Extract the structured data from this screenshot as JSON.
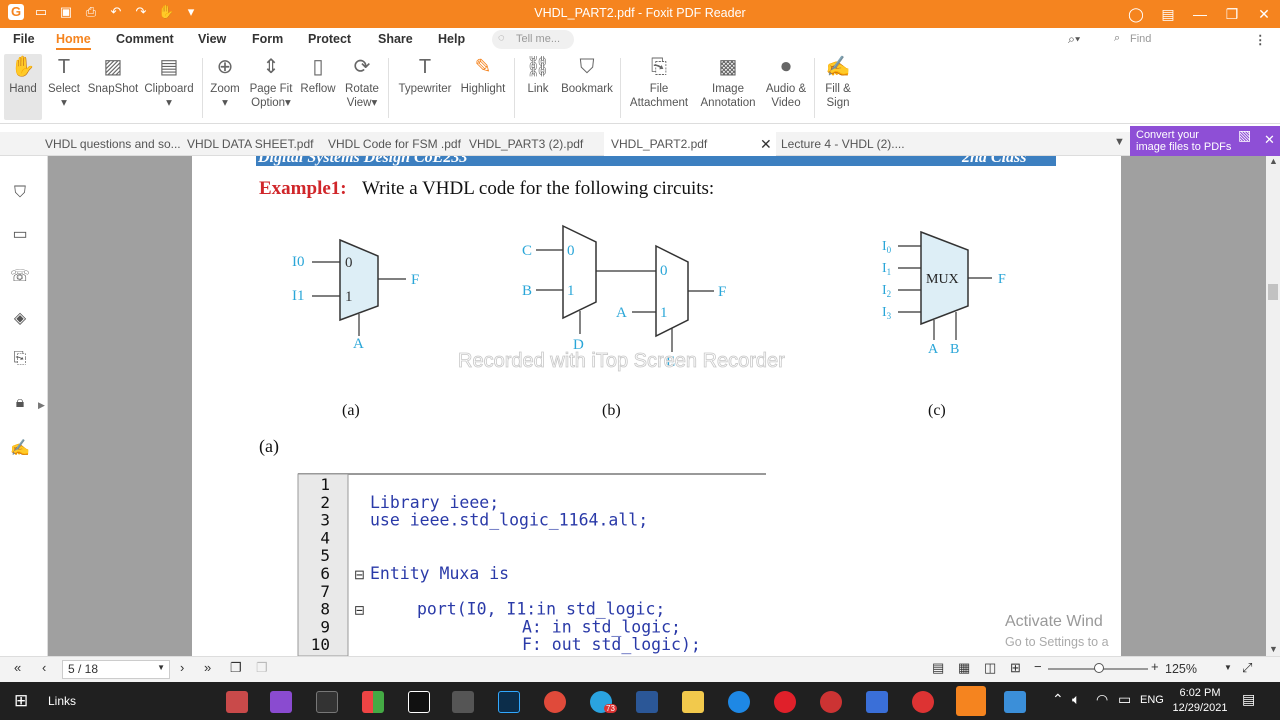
{
  "window": {
    "title": "VHDL_PART2.pdf - Foxit PDF Reader"
  },
  "menu": [
    "File",
    "Home",
    "Comment",
    "View",
    "Form",
    "Protect",
    "Share",
    "Help"
  ],
  "active_menu": "Home",
  "tellme_placeholder": "Tell me...",
  "find_placeholder": "Find",
  "ribbon": [
    {
      "label": "Hand",
      "icon": "hand-icon"
    },
    {
      "label": "Select",
      "icon": "select-icon"
    },
    {
      "label": "SnapShot",
      "icon": "snapshot-icon"
    },
    {
      "label": "Clipboard",
      "icon": "clipboard-icon"
    },
    {
      "label": "Zoom",
      "icon": "zoom-icon"
    },
    {
      "label": "Page Fit Option",
      "icon": "page-fit-icon"
    },
    {
      "label": "Reflow",
      "icon": "reflow-icon"
    },
    {
      "label": "Rotate View",
      "icon": "rotate-icon"
    },
    {
      "label": "Typewriter",
      "icon": "typewriter-icon"
    },
    {
      "label": "Highlight",
      "icon": "highlight-icon"
    },
    {
      "label": "Link",
      "icon": "link-icon"
    },
    {
      "label": "Bookmark",
      "icon": "bookmark-icon"
    },
    {
      "label": "File Attachment",
      "icon": "attachment-icon"
    },
    {
      "label": "Image Annotation",
      "icon": "image-annotation-icon"
    },
    {
      "label": "Audio & Video",
      "icon": "audio-video-icon"
    },
    {
      "label": "Fill & Sign",
      "icon": "fill-sign-icon"
    }
  ],
  "tabs": [
    "VHDL questions and so...",
    "VHDL DATA SHEET.pdf",
    "VHDL Code for FSM .pdf",
    "VHDL_PART3 (2).pdf",
    "VHDL_PART2.pdf",
    "Lecture 4 - VHDL  (2)...."
  ],
  "active_tab": "VHDL_PART2.pdf",
  "promo": {
    "line1": "Convert your",
    "line2": "image files to PDFs"
  },
  "document": {
    "header_text": "Digital Systems Design CoE233",
    "header_right": "2nd Class",
    "example_label": "Example1:",
    "example_text": "Write a VHDL code for the following circuits:",
    "fig_a": {
      "in0": "I0",
      "in1": "I1",
      "sel": "A",
      "out": "F",
      "p0": "0",
      "p1": "1",
      "caption": "(a)"
    },
    "fig_b": {
      "c": "C",
      "b": "B",
      "d": "D",
      "a": "A",
      "e": "E",
      "f": "F",
      "p0": "0",
      "p1": "1",
      "q0": "0",
      "q1": "1",
      "caption": "(b)"
    },
    "fig_c": {
      "i0": "I",
      "i1": "I",
      "i2": "I",
      "i3": "I",
      "s0": "0",
      "s1": "1",
      "s2": "2",
      "s3": "3",
      "mux": "MUX",
      "f": "F",
      "a": "A",
      "b": "B",
      "caption": "(c)"
    },
    "watermark": "Recorded with iTop Screen Recorder",
    "section": "(a)",
    "code_lines": [
      {
        "n": "1",
        "text": ""
      },
      {
        "n": "2",
        "text": "Library ieee;"
      },
      {
        "n": "3",
        "text": "use  ieee.std_logic_1164.all;"
      },
      {
        "n": "4",
        "text": ""
      },
      {
        "n": "5",
        "text": ""
      },
      {
        "n": "6",
        "text": "Entity Muxa is"
      },
      {
        "n": "7",
        "text": ""
      },
      {
        "n": "8",
        "text": "port(I0, I1:in std_logic;"
      },
      {
        "n": "9",
        "text": "A: in std_logic;"
      },
      {
        "n": "10",
        "text": "F: out std_logic);"
      }
    ],
    "activate_line1": "Activate Wind",
    "activate_line2": "Go to Settings to a"
  },
  "status": {
    "page": "5 / 18",
    "zoom": "125%"
  },
  "taskbar": {
    "links": "Links",
    "time": "6:02 PM",
    "date": "12/29/2021",
    "lang": "ENG",
    "badge": "73"
  },
  "colors": {
    "accent": "#f5841f",
    "figure_blue": "#2aa6d8",
    "example_red": "#d0262a",
    "promo": "#8e4fd6"
  }
}
